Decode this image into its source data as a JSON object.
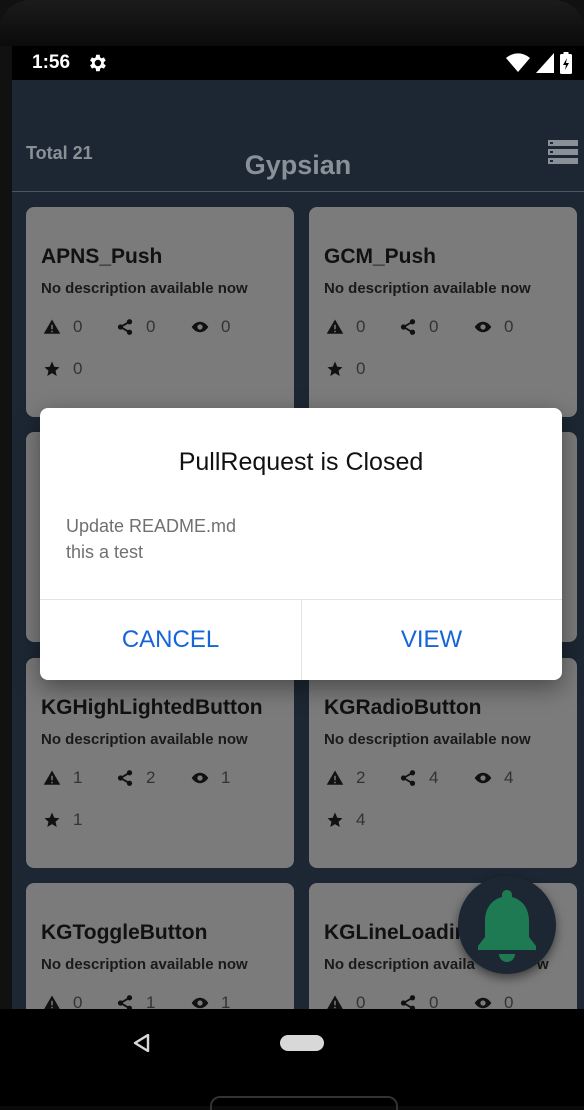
{
  "status_bar": {
    "time": "1:56"
  },
  "app_bar": {
    "total": "Total 21",
    "title": "Gypsian"
  },
  "cards": [
    {
      "name": "APNS_Push",
      "description": "No description available now",
      "issues": "0",
      "forks": "0",
      "watchers": "0",
      "stars": "0"
    },
    {
      "name": "GCM_Push",
      "description": "No description available now",
      "issues": "0",
      "forks": "0",
      "watchers": "0",
      "stars": "0"
    },
    {
      "name": "KGHighLightedButton",
      "description": "No description available now",
      "issues": "1",
      "forks": "2",
      "watchers": "1",
      "stars": "1"
    },
    {
      "name": "KGRadioButton",
      "description": "No description available now",
      "issues": "2",
      "forks": "4",
      "watchers": "4",
      "stars": "4"
    },
    {
      "name": "KGToggleButton",
      "description": "No description available now",
      "issues": "0",
      "forks": "1",
      "watchers": "1",
      "stars": ""
    },
    {
      "name": "KGLineLoadin",
      "description": "No description availa",
      "description_tail": "w",
      "issues": "0",
      "forks": "0",
      "watchers": "0",
      "stars": ""
    }
  ],
  "dialog": {
    "title": "PullRequest is Closed",
    "message_line1": "Update README.md",
    "message_line2": "this a test",
    "cancel_label": "CANCEL",
    "view_label": "VIEW"
  },
  "colors": {
    "screen_bg": "#1c2733",
    "card_bg": "#7b7b7b",
    "accent": "#1565d8",
    "fab_bell": "#1e7a52"
  },
  "icons": {
    "status": [
      "gear-icon",
      "wifi-icon",
      "signal-icon",
      "battery-icon"
    ],
    "stats": [
      "warning-icon",
      "share-icon",
      "eye-icon",
      "star-icon"
    ],
    "fab": "bell-icon"
  }
}
